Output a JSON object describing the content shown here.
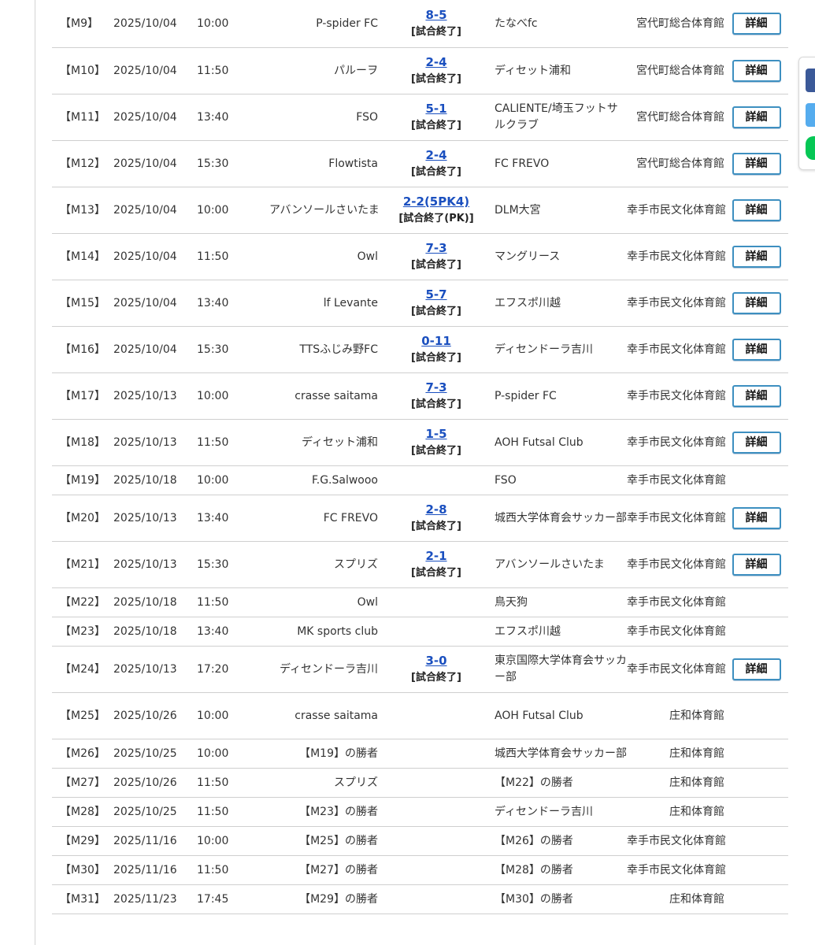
{
  "colors": {
    "link": "#1a4fbf",
    "button_border": "#3d8fc0",
    "facebook": "#3b5998",
    "twitter": "#55acee",
    "line": "#06c755"
  },
  "share_icons": [
    "facebook-icon",
    "twitter-icon",
    "line-icon"
  ],
  "matches": [
    {
      "id": "【M9】",
      "date": "2025/10/04",
      "time": "10:00",
      "home": "P-spider FC",
      "score": "8-5",
      "status": "[試合終了]",
      "away": "たなべfc",
      "venue": "宮代町総合体育館",
      "detail": "詳細"
    },
    {
      "id": "【M10】",
      "date": "2025/10/04",
      "time": "11:50",
      "home": "パルーヲ",
      "score": "2-4",
      "status": "[試合終了]",
      "away": "ディセット浦和",
      "venue": "宮代町総合体育館",
      "detail": "詳細"
    },
    {
      "id": "【M11】",
      "date": "2025/10/04",
      "time": "13:40",
      "home": "FSO",
      "score": "5-1",
      "status": "[試合終了]",
      "away": "CALIENTE/埼玉フットサルクラブ",
      "venue": "宮代町総合体育館",
      "detail": "詳細"
    },
    {
      "id": "【M12】",
      "date": "2025/10/04",
      "time": "15:30",
      "home": "Flowtista",
      "score": "2-4",
      "status": "[試合終了]",
      "away": "FC FREVO",
      "venue": "宮代町総合体育館",
      "detail": "詳細"
    },
    {
      "id": "【M13】",
      "date": "2025/10/04",
      "time": "10:00",
      "home": "アバンソールさいたま",
      "score": "2-2(5PK4)",
      "status": "[試合終了(PK)]",
      "away": "DLM大宮",
      "venue": "幸手市民文化体育館",
      "detail": "詳細"
    },
    {
      "id": "【M14】",
      "date": "2025/10/04",
      "time": "11:50",
      "home": "Owl",
      "score": "7-3",
      "status": "[試合終了]",
      "away": "マングリース",
      "venue": "幸手市民文化体育館",
      "detail": "詳細"
    },
    {
      "id": "【M15】",
      "date": "2025/10/04",
      "time": "13:40",
      "home": "lf Levante",
      "score": "5-7",
      "status": "[試合終了]",
      "away": "エフスポ川越",
      "venue": "幸手市民文化体育館",
      "detail": "詳細"
    },
    {
      "id": "【M16】",
      "date": "2025/10/04",
      "time": "15:30",
      "home": "TTSふじみ野FC",
      "score": "0-11",
      "status": "[試合終了]",
      "away": "ディセンドーラ吉川",
      "venue": "幸手市民文化体育館",
      "detail": "詳細"
    },
    {
      "id": "【M17】",
      "date": "2025/10/13",
      "time": "10:00",
      "home": "crasse saitama",
      "score": "7-3",
      "status": "[試合終了]",
      "away": "P-spider FC",
      "venue": "幸手市民文化体育館",
      "detail": "詳細"
    },
    {
      "id": "【M18】",
      "date": "2025/10/13",
      "time": "11:50",
      "home": "ディセット浦和",
      "score": "1-5",
      "status": "[試合終了]",
      "away": "AOH Futsal Club",
      "venue": "幸手市民文化体育館",
      "detail": "詳細"
    },
    {
      "id": "【M19】",
      "date": "2025/10/18",
      "time": "10:00",
      "home": "F.G.Salwooo",
      "score": "",
      "status": "",
      "away": "FSO",
      "venue": "幸手市民文化体育館",
      "detail": ""
    },
    {
      "id": "【M20】",
      "date": "2025/10/13",
      "time": "13:40",
      "home": "FC FREVO",
      "score": "2-8",
      "status": "[試合終了]",
      "away": "城西大学体育会サッカー部",
      "venue": "幸手市民文化体育館",
      "detail": "詳細"
    },
    {
      "id": "【M21】",
      "date": "2025/10/13",
      "time": "15:30",
      "home": "スプリズ",
      "score": "2-1",
      "status": "[試合終了]",
      "away": "アバンソールさいたま",
      "venue": "幸手市民文化体育館",
      "detail": "詳細"
    },
    {
      "id": "【M22】",
      "date": "2025/10/18",
      "time": "11:50",
      "home": "Owl",
      "score": "",
      "status": "",
      "away": "鳥天狗",
      "venue": "幸手市民文化体育館",
      "detail": ""
    },
    {
      "id": "【M23】",
      "date": "2025/10/18",
      "time": "13:40",
      "home": "MK sports club",
      "score": "",
      "status": "",
      "away": "エフスポ川越",
      "venue": "幸手市民文化体育館",
      "detail": ""
    },
    {
      "id": "【M24】",
      "date": "2025/10/13",
      "time": "17:20",
      "home": "ディセンドーラ吉川",
      "score": "3-0",
      "status": "[試合終了]",
      "away": "東京国際大学体育会サッカー部",
      "venue": "幸手市民文化体育館",
      "detail": "詳細"
    },
    {
      "id": "【M25】",
      "date": "2025/10/26",
      "time": "10:00",
      "home": "crasse saitama",
      "score": "",
      "status": "",
      "away": "AOH Futsal Club",
      "venue": "庄和体育館",
      "detail": ""
    },
    {
      "id": "【M26】",
      "date": "2025/10/25",
      "time": "10:00",
      "home": "【M19】の勝者",
      "score": "",
      "status": "",
      "away": "城西大学体育会サッカー部",
      "venue": "庄和体育館",
      "detail": ""
    },
    {
      "id": "【M27】",
      "date": "2025/10/26",
      "time": "11:50",
      "home": "スプリズ",
      "score": "",
      "status": "",
      "away": "【M22】の勝者",
      "venue": "庄和体育館",
      "detail": ""
    },
    {
      "id": "【M28】",
      "date": "2025/10/25",
      "time": "11:50",
      "home": "【M23】の勝者",
      "score": "",
      "status": "",
      "away": "ディセンドーラ吉川",
      "venue": "庄和体育館",
      "detail": ""
    },
    {
      "id": "【M29】",
      "date": "2025/11/16",
      "time": "10:00",
      "home": "【M25】の勝者",
      "score": "",
      "status": "",
      "away": "【M26】の勝者",
      "venue": "幸手市民文化体育館",
      "detail": ""
    },
    {
      "id": "【M30】",
      "date": "2025/11/16",
      "time": "11:50",
      "home": "【M27】の勝者",
      "score": "",
      "status": "",
      "away": "【M28】の勝者",
      "venue": "幸手市民文化体育館",
      "detail": ""
    },
    {
      "id": "【M31】",
      "date": "2025/11/23",
      "time": "17:45",
      "home": "【M29】の勝者",
      "score": "",
      "status": "",
      "away": "【M30】の勝者",
      "venue": "庄和体育館",
      "detail": ""
    }
  ]
}
